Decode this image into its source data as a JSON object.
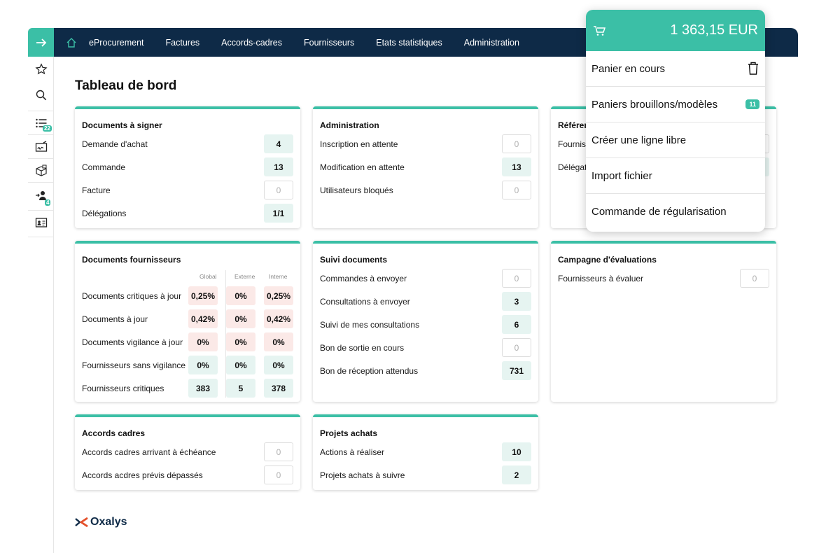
{
  "nav": {
    "items": [
      "eProcurement",
      "Factures",
      "Accords-cadres",
      "Fournisseurs",
      "Etats statistiques",
      "Administration"
    ]
  },
  "rail": {
    "list_badge": "22",
    "user_badge": "4"
  },
  "page_title": "Tableau de bord",
  "cards": {
    "docs_signer": {
      "title": "Documents à signer",
      "rows": [
        {
          "label": "Demande d'achat",
          "value": "4"
        },
        {
          "label": "Commande",
          "value": "13"
        },
        {
          "label": "Facture",
          "value": "0"
        },
        {
          "label": "Délégations",
          "value": "1/1"
        }
      ]
    },
    "administration": {
      "title": "Administration",
      "rows": [
        {
          "label": "Inscription en attente",
          "value": "0"
        },
        {
          "label": "Modification en attente",
          "value": "13"
        },
        {
          "label": "Utilisateurs bloqués",
          "value": "0"
        }
      ]
    },
    "referentiel": {
      "title": "Référer",
      "rows": [
        {
          "label": "Fournis"
        },
        {
          "label": "Délégat"
        }
      ]
    },
    "docs_fournisseurs": {
      "title": "Documents fournisseurs",
      "columns": [
        "Global",
        "Externe",
        "Interne"
      ],
      "rows": [
        {
          "label": "Documents critiques à jour",
          "values": [
            "0,25%",
            "0%",
            "0,25%"
          ]
        },
        {
          "label": "Documents à jour",
          "values": [
            "0,42%",
            "0%",
            "0,42%"
          ]
        },
        {
          "label": "Documents vigilance à jour",
          "values": [
            "0%",
            "0%",
            "0%"
          ]
        },
        {
          "label": "Fournisseurs sans vigilance",
          "values": [
            "0%",
            "0%",
            "0%"
          ]
        },
        {
          "label": "Fournisseurs critiques",
          "values": [
            "383",
            "5",
            "378"
          ]
        }
      ]
    },
    "suivi_documents": {
      "title": "Suivi documents",
      "rows": [
        {
          "label": "Commandes à envoyer",
          "value": "0"
        },
        {
          "label": "Consultations à envoyer",
          "value": "3"
        },
        {
          "label": "Suivi de mes consultations",
          "value": "6"
        },
        {
          "label": "Bon de sortie en cours",
          "value": "0"
        },
        {
          "label": "Bon de réception attendus",
          "value": "731"
        }
      ]
    },
    "campagne": {
      "title": "Campagne d'évaluations",
      "rows": [
        {
          "label": "Fournisseurs à évaluer",
          "value": "0"
        }
      ]
    },
    "accords": {
      "title": "Accords cadres",
      "rows": [
        {
          "label": "Accords cadres arrivant à échéance",
          "value": "0"
        },
        {
          "label": "Accords acdres prévis dépassés",
          "value": "0"
        }
      ]
    },
    "projets": {
      "title": "Projets achats",
      "rows": [
        {
          "label": "Actions à réaliser",
          "value": "10"
        },
        {
          "label": "Projets achats à suivre",
          "value": "2"
        }
      ]
    }
  },
  "cart": {
    "total": "1 363,15 EUR",
    "items": [
      {
        "label": "Panier en cours"
      },
      {
        "label": "Paniers brouillons/modèles",
        "badge": "11"
      },
      {
        "label": "Créer une ligne libre"
      },
      {
        "label": "Import fichier"
      },
      {
        "label": "Commande de régularisation"
      }
    ]
  },
  "logo": {
    "text": "Oxalys"
  },
  "colors": {
    "accent": "#3bbfa6",
    "navy": "#0e2a47"
  }
}
